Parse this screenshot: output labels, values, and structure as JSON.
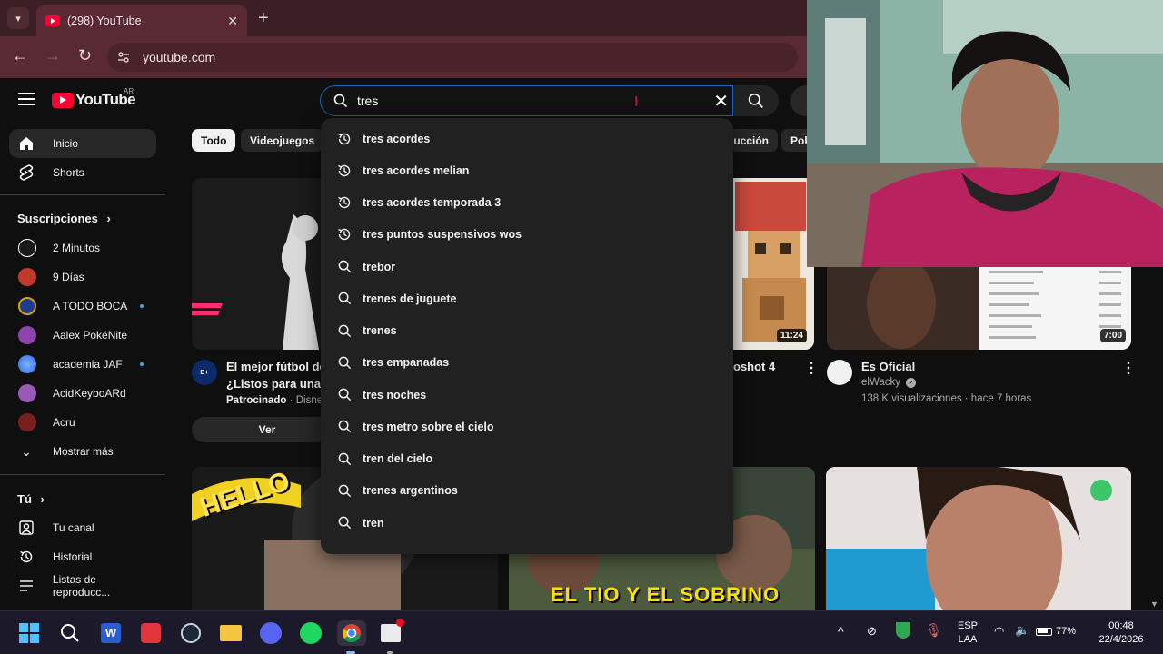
{
  "browser": {
    "tab_title": "(298) YouTube",
    "url": "youtube.com"
  },
  "youtube": {
    "logo_text": "YouTube",
    "country_code": "AR",
    "search_value": "tres"
  },
  "sidebar": {
    "main": [
      {
        "label": "Inicio",
        "icon": "home-icon"
      },
      {
        "label": "Shorts",
        "icon": "shorts-icon"
      }
    ],
    "subscriptions_heading": "Suscripciones",
    "subscriptions": [
      {
        "label": "2 Minutos",
        "color": "#1a1a1a",
        "new": false
      },
      {
        "label": "9 Días",
        "color": "#c0392b",
        "new": false
      },
      {
        "label": "A TODO BOCA",
        "color": "#1d3c8f",
        "new": true
      },
      {
        "label": "Aalex PokéNite",
        "color": "#8e44ad",
        "new": false
      },
      {
        "label": "academia JAF",
        "color": "#2d6cdf",
        "new": true
      },
      {
        "label": "AcidKeyboARd",
        "color": "#9b59b6",
        "new": false
      },
      {
        "label": "Acru",
        "color": "#7a1f1f",
        "new": false
      }
    ],
    "show_more": "Mostrar más",
    "you_heading": "Tú",
    "you_items": [
      {
        "label": "Tu canal",
        "icon": "user-box-icon"
      },
      {
        "label": "Historial",
        "icon": "history-icon"
      },
      {
        "label": "Listas de reproducc...",
        "icon": "playlist-icon"
      }
    ]
  },
  "chips": {
    "all": "Todo",
    "games": "Videojuegos",
    "partial_production": "ducción",
    "partial_poker": "Pok"
  },
  "videos": {
    "ad": {
      "title_line1": "El mejor fútbol de",
      "title_line2": "¿Listos para una n",
      "sponsored": "Patrocinado",
      "advertiser": "Disney",
      "cta": "Ver"
    },
    "minecraft": {
      "duration": "11:24",
      "title_partial": "oshot 4"
    },
    "es_oficial": {
      "duration": "7:00",
      "title": "Es Oficial",
      "channel": "elWacky",
      "stats": "138 K visualizaciones · hace 7 horas"
    },
    "row2_caption": "EL TIO Y EL SOBRINO",
    "row2_hello": "HELLO"
  },
  "suggestions": [
    {
      "text": "tres acordes",
      "type": "history"
    },
    {
      "text": "tres acordes melian",
      "type": "history"
    },
    {
      "text": "tres acordes temporada 3",
      "type": "history"
    },
    {
      "text": "tres puntos suspensivos wos",
      "type": "history"
    },
    {
      "text": "trebor",
      "type": "search"
    },
    {
      "text": "trenes de juguete",
      "type": "search"
    },
    {
      "text": "trenes",
      "type": "search"
    },
    {
      "text": "tres empanadas",
      "type": "search"
    },
    {
      "text": "tres noches",
      "type": "search"
    },
    {
      "text": "tres metro sobre el cielo",
      "type": "search"
    },
    {
      "text": "tren del cielo",
      "type": "search"
    },
    {
      "text": "trenes argentinos",
      "type": "search"
    },
    {
      "text": "tren",
      "type": "search"
    }
  ],
  "taskbar": {
    "language": "ESP",
    "layout": "LAA",
    "battery": "77%",
    "time": "00:48",
    "date": "22/4/2026"
  },
  "colors": {
    "youtube_red": "#ff0033",
    "browser_frame": "#5a2a34",
    "search_focus": "#1c62b9"
  }
}
